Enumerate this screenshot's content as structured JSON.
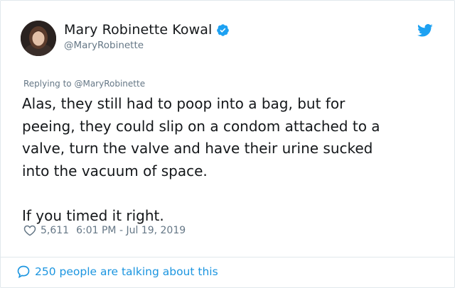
{
  "author": {
    "name": "Mary Robinette Kowal",
    "handle": "@MaryRobinette",
    "verified": true
  },
  "reply": {
    "prefix": "Replying to ",
    "mention": "@MaryRobinette"
  },
  "tweet": {
    "text": "Alas, they still had to poop into a bag, but for\npeeing, they could slip on a condom attached to a\nvalve, turn the valve and have their urine sucked\ninto the vacuum of space.\n\nIf you timed it right."
  },
  "meta": {
    "likes": "5,611",
    "timestamp": "6:01 PM - Jul 19, 2019"
  },
  "footer": {
    "talking": "250 people are talking about this"
  },
  "icons": {
    "verified": "verified-badge-icon",
    "brand": "twitter-bird-icon",
    "like": "heart-icon",
    "reply": "speech-bubble-icon"
  },
  "colors": {
    "accent": "#1da1f2",
    "link": "#1b95e0",
    "muted": "#657786",
    "text": "#14171a"
  }
}
